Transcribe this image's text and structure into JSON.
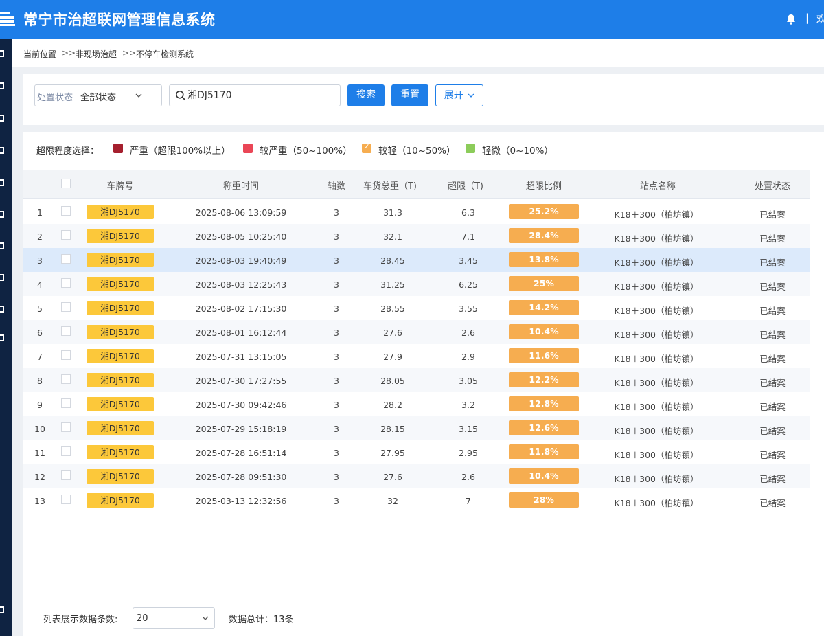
{
  "header": {
    "title": "常宁市治超联网管理信息系统",
    "user_greeting": "欢",
    "separator": "|"
  },
  "breadcrumb": [
    "当前位置",
    "非现场治超",
    "不停车检测系统"
  ],
  "breadcrumb_separator": ">>",
  "filters": {
    "status_label": "处置状态",
    "status_value": "全部状态",
    "search_value": "湘DJ5170",
    "search_button": "搜索",
    "reset_button": "重置",
    "expand_button": "展开"
  },
  "legend": {
    "title": "超限程度选择：",
    "items": [
      {
        "label": "严重（超限100%以上）",
        "color": "#a51f2e",
        "checked": false
      },
      {
        "label": "较严重（50~100%）",
        "color": "#ea4656",
        "checked": false
      },
      {
        "label": "较轻（10~50%）",
        "color": "#f6ad50",
        "checked": true
      },
      {
        "label": "轻微（0~10%）",
        "color": "#8ccc5a",
        "checked": false
      }
    ]
  },
  "table": {
    "columns": [
      "车牌号",
      "称重时间",
      "轴数",
      "车货总重（T)",
      "超限（T)",
      "超限比例",
      "站点名称",
      "处置状态"
    ],
    "rows": [
      {
        "no": "1",
        "plate": "湘DJ5170",
        "time": "2025-08-06 13:09:59",
        "axles": "3",
        "gross": "31.3",
        "over": "6.3",
        "ratio": "25.2%",
        "site": "K18＋300（柏坊镇）",
        "status": "已结案"
      },
      {
        "no": "2",
        "plate": "湘DJ5170",
        "time": "2025-08-05 10:25:40",
        "axles": "3",
        "gross": "32.1",
        "over": "7.1",
        "ratio": "28.4%",
        "site": "K18＋300（柏坊镇）",
        "status": "已结案"
      },
      {
        "no": "3",
        "plate": "湘DJ5170",
        "time": "2025-08-03 19:40:49",
        "axles": "3",
        "gross": "28.45",
        "over": "3.45",
        "ratio": "13.8%",
        "site": "K18＋300（柏坊镇）",
        "status": "已结案"
      },
      {
        "no": "4",
        "plate": "湘DJ5170",
        "time": "2025-08-03 12:25:43",
        "axles": "3",
        "gross": "31.25",
        "over": "6.25",
        "ratio": "25%",
        "site": "K18＋300（柏坊镇）",
        "status": "已结案"
      },
      {
        "no": "5",
        "plate": "湘DJ5170",
        "time": "2025-08-02 17:15:30",
        "axles": "3",
        "gross": "28.55",
        "over": "3.55",
        "ratio": "14.2%",
        "site": "K18＋300（柏坊镇）",
        "status": "已结案"
      },
      {
        "no": "6",
        "plate": "湘DJ5170",
        "time": "2025-08-01 16:12:44",
        "axles": "3",
        "gross": "27.6",
        "over": "2.6",
        "ratio": "10.4%",
        "site": "K18＋300（柏坊镇）",
        "status": "已结案"
      },
      {
        "no": "7",
        "plate": "湘DJ5170",
        "time": "2025-07-31 13:15:05",
        "axles": "3",
        "gross": "27.9",
        "over": "2.9",
        "ratio": "11.6%",
        "site": "K18＋300（柏坊镇）",
        "status": "已结案"
      },
      {
        "no": "8",
        "plate": "湘DJ5170",
        "time": "2025-07-30 17:27:55",
        "axles": "3",
        "gross": "28.05",
        "over": "3.05",
        "ratio": "12.2%",
        "site": "K18＋300（柏坊镇）",
        "status": "已结案"
      },
      {
        "no": "9",
        "plate": "湘DJ5170",
        "time": "2025-07-30 09:42:46",
        "axles": "3",
        "gross": "28.2",
        "over": "3.2",
        "ratio": "12.8%",
        "site": "K18＋300（柏坊镇）",
        "status": "已结案"
      },
      {
        "no": "10",
        "plate": "湘DJ5170",
        "time": "2025-07-29 15:18:19",
        "axles": "3",
        "gross": "28.15",
        "over": "3.15",
        "ratio": "12.6%",
        "site": "K18＋300（柏坊镇）",
        "status": "已结案"
      },
      {
        "no": "11",
        "plate": "湘DJ5170",
        "time": "2025-07-28 16:51:14",
        "axles": "3",
        "gross": "27.95",
        "over": "2.95",
        "ratio": "11.8%",
        "site": "K18＋300（柏坊镇）",
        "status": "已结案"
      },
      {
        "no": "12",
        "plate": "湘DJ5170",
        "time": "2025-07-28 09:51:30",
        "axles": "3",
        "gross": "27.6",
        "over": "2.6",
        "ratio": "10.4%",
        "site": "K18＋300（柏坊镇）",
        "status": "已结案"
      },
      {
        "no": "13",
        "plate": "湘DJ5170",
        "time": "2025-03-13 12:32:56",
        "axles": "3",
        "gross": "32",
        "over": "7",
        "ratio": "28%",
        "site": "K18＋300（柏坊镇）",
        "status": "已结案"
      }
    ]
  },
  "footer": {
    "page_size_label": "列表展示数据条数:",
    "page_size_value": "20",
    "total_text": "数据总计：13条"
  },
  "colors": {
    "brand": "#1e7ee8",
    "sidebar": "#0f2342",
    "plate": "#fcc83a",
    "ratio_light": "#f6ad50",
    "row_highlight": "#dceafb"
  }
}
